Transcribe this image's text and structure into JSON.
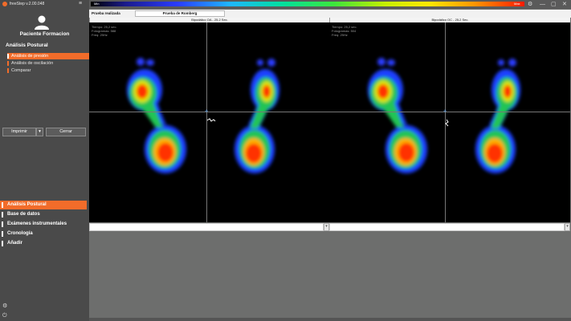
{
  "app": {
    "title": "freeStep v.2.00.048"
  },
  "window_controls": {
    "settings": "⚙",
    "minimize": "—",
    "maximize": "▢",
    "close": "✕",
    "collapse": "≡"
  },
  "sidebar": {
    "patient_name": "Paciente Formacion",
    "section_title": "Análisis Postural",
    "sub_items": [
      {
        "label": "Análisis de presión",
        "active": true
      },
      {
        "label": "Análisis de oscilación",
        "active": false
      },
      {
        "label": "Comparar",
        "active": false
      }
    ],
    "print_label": "Imprimir",
    "print_arrow": "▾",
    "close_label": "Cerrar",
    "nav_items": [
      {
        "label": "Análisis Postural",
        "active": true
      },
      {
        "label": "Base de datos",
        "active": false
      },
      {
        "label": "Exámenes instrumentales",
        "active": false
      },
      {
        "label": "Cronología",
        "active": false
      },
      {
        "label": "Añadir",
        "active": false
      }
    ],
    "bottom_icons": {
      "settings": "⚙",
      "power": "⏻"
    }
  },
  "scale": {
    "min_label": "Min",
    "max_label": "Max"
  },
  "prueba": {
    "label": "Prueba realizada",
    "value": "Prueba de Romberg"
  },
  "panels": [
    {
      "title": "Bipodálico OA - 25,2 Sec.",
      "stats": [
        "Tiempo: 25,2 sec.",
        "Fotogramas: 588",
        "Freq: 25Hz"
      ]
    },
    {
      "title": "Bipodálico OC - 25,2 Sec.",
      "stats": [
        "Tiempo: 25,2 sec.",
        "Fotogramas: 504",
        "Freq: 25Hz"
      ]
    }
  ],
  "colors": {
    "accent": "#f26c2a",
    "sidebar": "#4a4a4a",
    "background": "#6d6e6d",
    "cog_marker": "#6bb4ff"
  },
  "icons": {
    "cog_marker": "✛",
    "scroll_down": "▾"
  }
}
